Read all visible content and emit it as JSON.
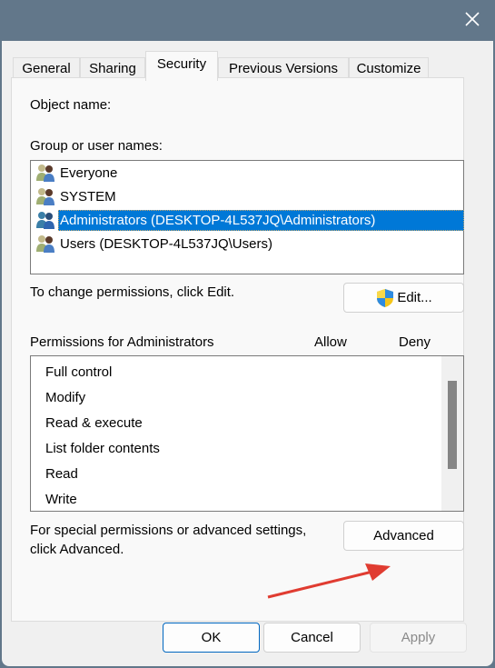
{
  "window": {
    "close_icon": "close-icon"
  },
  "tabs": [
    {
      "label": "General",
      "active": false
    },
    {
      "label": "Sharing",
      "active": false
    },
    {
      "label": "Security",
      "active": true
    },
    {
      "label": "Previous Versions",
      "active": false
    },
    {
      "label": "Customize",
      "active": false
    }
  ],
  "security": {
    "object_name_label": "Object name:",
    "object_name_value": "",
    "group_label": "Group or user names:",
    "groups": [
      {
        "name": "Everyone",
        "icon": "users-group-icon",
        "selected": false
      },
      {
        "name": "SYSTEM",
        "icon": "users-group-icon",
        "selected": false
      },
      {
        "name": "Administrators (DESKTOP-4L537JQ\\Administrators)",
        "icon": "users-group-icon",
        "selected": true
      },
      {
        "name": "Users (DESKTOP-4L537JQ\\Users)",
        "icon": "users-group-icon",
        "selected": false
      }
    ],
    "change_hint": "To change permissions, click Edit.",
    "edit_button": "Edit...",
    "permissions_label": "Permissions for Administrators",
    "allow_header": "Allow",
    "deny_header": "Deny",
    "permissions": [
      {
        "name": "Full control",
        "allow": false,
        "deny": false
      },
      {
        "name": "Modify",
        "allow": false,
        "deny": false
      },
      {
        "name": "Read & execute",
        "allow": false,
        "deny": false
      },
      {
        "name": "List folder contents",
        "allow": false,
        "deny": false
      },
      {
        "name": "Read",
        "allow": false,
        "deny": false
      },
      {
        "name": "Write",
        "allow": false,
        "deny": false
      }
    ],
    "advanced_hint_line1": "For special permissions or advanced settings,",
    "advanced_hint_line2": "click Advanced.",
    "advanced_button": "Advanced"
  },
  "footer": {
    "ok": "OK",
    "cancel": "Cancel",
    "apply": "Apply"
  },
  "colors": {
    "selection": "#0078d7",
    "annotation_arrow": "#e03c31",
    "titlebar": "#62778a"
  }
}
